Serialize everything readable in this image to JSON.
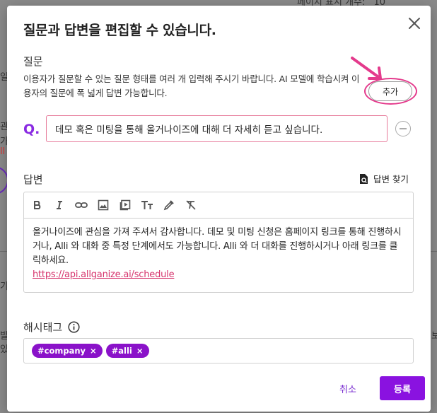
{
  "background": {
    "top_text": "페이지 표시 개수:",
    "top_value": "10",
    "frag_1": "관",
    "frag_2": "일",
    "frag_3": "가",
    "frag_4": "ll",
    "frag_5": "발",
    "frag_6": "있",
    "frag_7": "기",
    "frag_8": "보"
  },
  "modal": {
    "title": "질문과 답변을 편집할 수 있습니다.",
    "question_section": {
      "label": "질문",
      "description": "이용자가 질문할 수 있는 질문 형태를 여러 개 입력해 주시기 바랍니다. AI 모델에 학습시켜 이용자의 질문에 폭 넓게 답변 가능합니다.",
      "add_button": "추가",
      "q_marker": "Q.",
      "question_value": "데모 혹은 미팅을 통해 올거나이즈에 대해 더 자세히 듣고 싶습니다."
    },
    "answer_section": {
      "label": "답변",
      "find_answer": "답변 찾기",
      "toolbar": [
        "bold-icon",
        "italic-icon",
        "link-icon",
        "image-icon",
        "video-icon",
        "text-size-icon",
        "color-picker-icon",
        "clear-format-icon"
      ],
      "body_text": "올거나이즈에 관심을 가져 주셔서 감사합니다. 데모 및 미팅 신청은 홈페이지 링크를 통해 진행하시거나, Alli 와 대화 중 특정 단계에서도 가능합니다. Alli 와 더 대화를 진행하시거나 아래 링크를 클릭하세요.",
      "link_text": "https://api.allganize.ai/schedule"
    },
    "hashtag_section": {
      "label": "해시태그",
      "tags": [
        "#company",
        "#alli"
      ]
    },
    "cancel_button": "취소",
    "submit_button": "등록"
  },
  "colors": {
    "accent": "#8a12e0",
    "highlight": "#e43a8c",
    "link": "#d6336c"
  }
}
